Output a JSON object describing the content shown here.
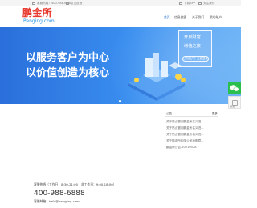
{
  "topbar": {
    "hotline": "客服热线：400-988-6888",
    "email": "意见反馈",
    "download": "下载APP",
    "wechat": "关注我们"
  },
  "logo": {
    "cn": "鹏金所",
    "en": "Penging.com"
  },
  "nav": {
    "items": [
      {
        "label": "首页",
        "active": true
      },
      {
        "label": "信息披露",
        "active": false
      },
      {
        "label": "关于我们",
        "active": false
      },
      {
        "label": "我的账户",
        "active": false
      }
    ]
  },
  "banner": {
    "slogan_1": "以服务客户为中心",
    "slogan_2": "以价值创造为核心",
    "panel_line_1": "开启财富",
    "panel_line_2": "增值之旅",
    "panel_button": "已有账户？立即登录",
    "colors": {
      "start": "#2a6fdb",
      "end": "#6cb3f6"
    }
  },
  "float_widget": {
    "label": "微信"
  },
  "notice": {
    "title": "公告",
    "more": "更多",
    "items": [
      "关于防止冒用鹏金所名义进...",
      "关于防止冒用鹏金所名义进...",
      "关于防止冒用鹏金所名义进...",
      "关于鹏金所相关公司声明暨...",
      "鹏金所公告-20210528"
    ]
  },
  "footer": {
    "service_hours": "客服热线（工作日：8:30-21:00　非工作日：9:00-18:00）",
    "phone": "400-988-6888",
    "email": "客服邮箱：kefu@pengjing.com"
  },
  "accent": "#1f6fd4",
  "brand_red": "#e8392f"
}
